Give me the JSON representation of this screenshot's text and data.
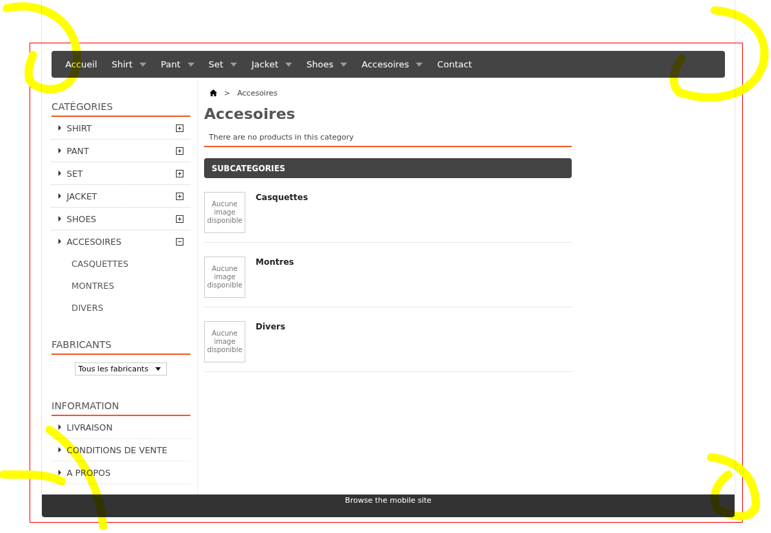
{
  "nav": [
    {
      "label": "Accueil",
      "dropdown": false
    },
    {
      "label": "Shirt",
      "dropdown": true
    },
    {
      "label": "Pant",
      "dropdown": true
    },
    {
      "label": "Set",
      "dropdown": true
    },
    {
      "label": "Jacket",
      "dropdown": true
    },
    {
      "label": "Shoes",
      "dropdown": true
    },
    {
      "label": "Accesoires",
      "dropdown": true
    },
    {
      "label": "Contact",
      "dropdown": false
    }
  ],
  "categories": {
    "title": "CATÉGORIES",
    "items": [
      {
        "label": "SHIRT",
        "expanded": false
      },
      {
        "label": "PANT",
        "expanded": false
      },
      {
        "label": "SET",
        "expanded": false
      },
      {
        "label": "JACKET",
        "expanded": false
      },
      {
        "label": "SHOES",
        "expanded": false
      },
      {
        "label": "ACCESOIRES",
        "expanded": true,
        "children": [
          {
            "label": "CASQUETTES"
          },
          {
            "label": "MONTRES"
          },
          {
            "label": "DIVERS"
          }
        ]
      }
    ]
  },
  "manufacturers": {
    "title": "FABRICANTS",
    "select": "Tous les fabricants"
  },
  "information": {
    "title": "INFORMATION",
    "items": [
      "LIVRAISON",
      "CONDITIONS DE VENTE",
      "A PROPOS"
    ]
  },
  "breadcrumb": {
    "separator": ">",
    "current": "Accesoires"
  },
  "page_title": "Accesoires",
  "notice": "There are no products in this category",
  "subcategories": {
    "title": "SUBCATEGORIES",
    "items": [
      {
        "name": "Casquettes",
        "image_text": "Aucune image disponible"
      },
      {
        "name": "Montres",
        "image_text": "Aucune image disponible"
      },
      {
        "name": "Divers",
        "image_text": "Aucune image disponible"
      }
    ]
  },
  "footer": {
    "link": "Browse the mobile site"
  }
}
